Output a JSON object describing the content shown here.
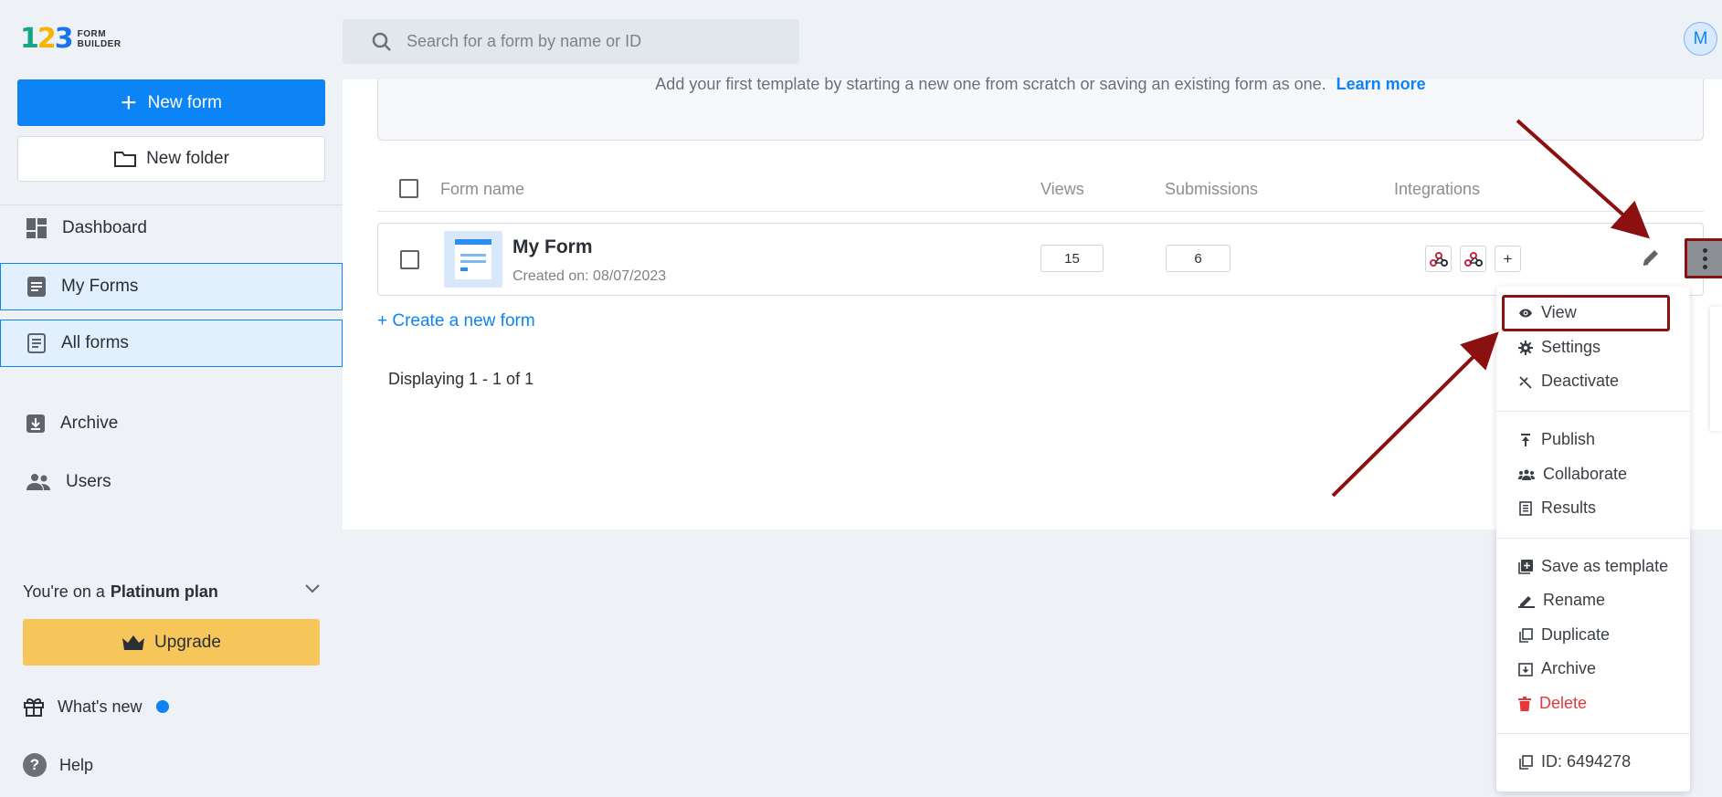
{
  "logo": {
    "number": "123",
    "line1": "FORM",
    "line2": "BUILDER"
  },
  "header": {
    "search_placeholder": "Search for a form by name or ID",
    "avatar_initial": "M"
  },
  "sidebar": {
    "new_form_label": "New form",
    "new_folder_label": "New folder",
    "items": [
      {
        "label": "Dashboard",
        "icon": "dashboard-icon",
        "active": false
      },
      {
        "label": "My Forms",
        "icon": "form-icon",
        "active": true
      },
      {
        "label": "All forms",
        "icon": "form-list-icon",
        "active": true
      },
      {
        "label": "Archive",
        "icon": "archive-icon",
        "active": false
      },
      {
        "label": "Users",
        "icon": "users-icon",
        "active": false
      }
    ],
    "plan_prefix": "You're on a",
    "plan_name": "Platinum plan",
    "upgrade_label": "Upgrade",
    "whats_new_label": "What's new",
    "help_label": "Help"
  },
  "main": {
    "template_message": "Add your first template by starting a new one from scratch or saving an existing form as one.",
    "learn_more_label": "Learn more",
    "columns": {
      "form_name": "Form name",
      "views": "Views",
      "submissions": "Submissions",
      "integrations": "Integrations"
    },
    "forms": [
      {
        "name": "My Form",
        "created": "Created on: 08/07/2023",
        "views": "15",
        "submissions": "6"
      }
    ],
    "create_link": "+ Create a new form",
    "displaying": "Displaying 1 - 1 of 1"
  },
  "menu": {
    "view": "View",
    "settings": "Settings",
    "deactivate": "Deactivate",
    "publish": "Publish",
    "collaborate": "Collaborate",
    "results": "Results",
    "save_as_template": "Save as template",
    "rename": "Rename",
    "duplicate": "Duplicate",
    "archive": "Archive",
    "delete": "Delete",
    "form_id": "ID: 6494278"
  },
  "colors": {
    "primary": "#0d84f5",
    "upgrade": "#f6c65b",
    "annotation": "#8b1010",
    "danger": "#e5383b"
  }
}
